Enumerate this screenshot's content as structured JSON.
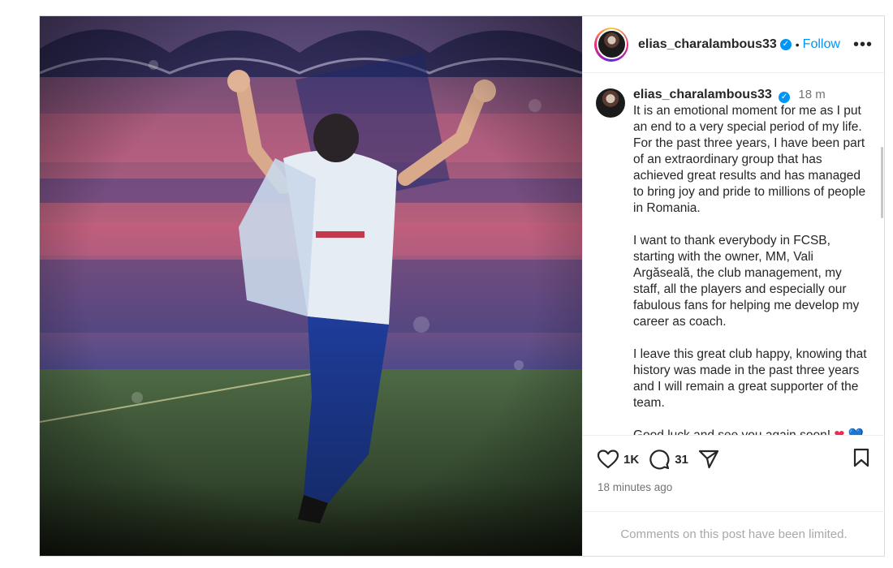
{
  "post": {
    "username": "elias_charalambous33",
    "follow_label": "Follow",
    "separator": "•",
    "more_label": "•••",
    "time_short": "18 m",
    "caption_paragraphs": [
      "It is an emotional moment for me as I put an end to a very special period of my life. For the past three years, I have been part of an extraordinary group that has achieved great results and has managed to bring joy and pride to millions of people in Romania.",
      "I want to thank everybody in FCSB, starting with the owner, MM, Vali Argăseală, the club management, my staff, all the players and especially our fabulous fans for helping me develop my career as coach.",
      "I leave this great club happy, knowing that history was made in the past three years and I will remain a great supporter of the team."
    ],
    "closing_text": "Good luck and see you again soon!",
    "closing_emoji_1": "❤",
    "closing_emoji_2": "💙",
    "likes_count": "1K",
    "comments_count": "31",
    "timestamp": "18 minutes ago",
    "comments_limited_notice": "Comments on this post have been limited."
  },
  "icons": {
    "verified": "verified-badge-icon",
    "like": "heart-icon",
    "comment": "comment-bubble-icon",
    "share": "paper-plane-icon",
    "save": "bookmark-icon"
  },
  "colors": {
    "accent": "#0095f6",
    "text": "#262626",
    "muted": "#737373",
    "notice": "#a8a8a8"
  }
}
